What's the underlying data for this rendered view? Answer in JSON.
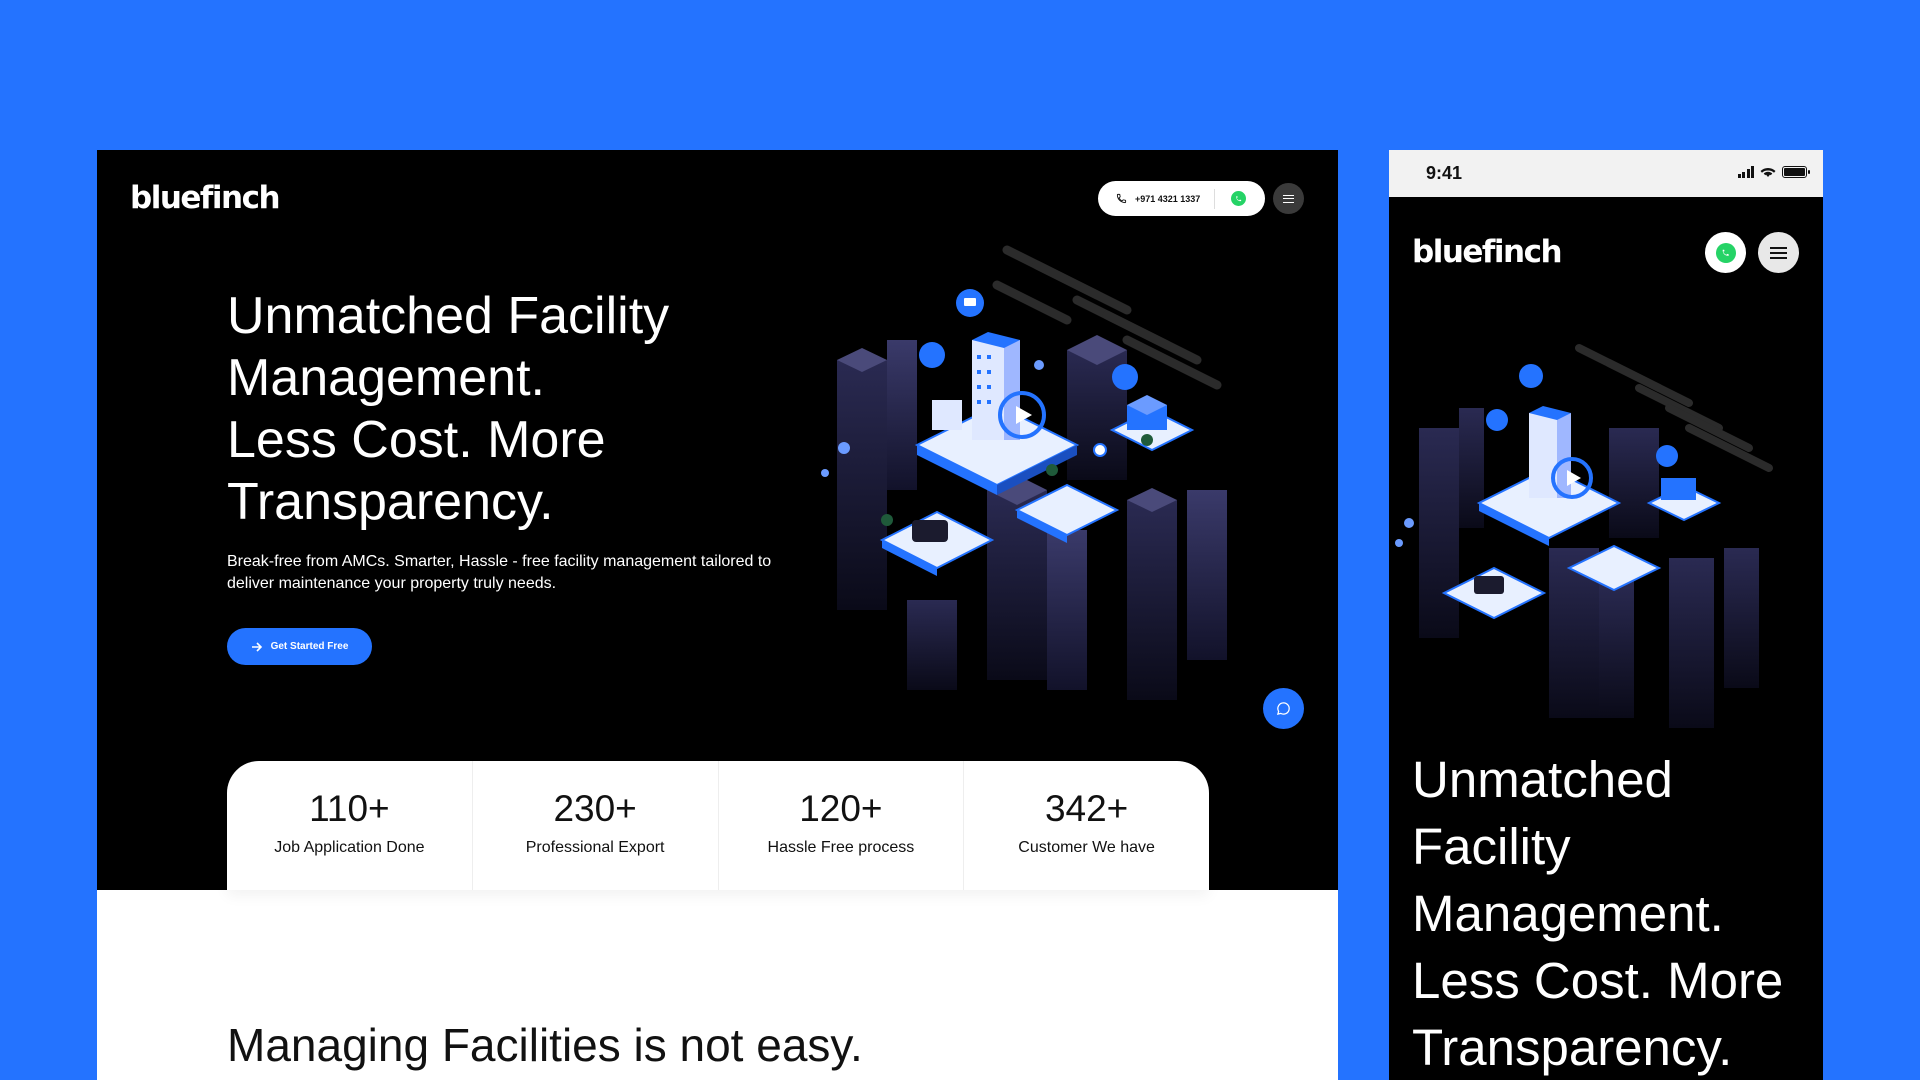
{
  "desktop": {
    "logo": "bluefinch",
    "phone_number": "+971 4321 1337",
    "headline": [
      "Unmatched Facility",
      "Management.",
      "Less Cost. More",
      "Transparency."
    ],
    "subheadline": "Break-free from AMCs. Smarter, Hassle - free facility management tailored to deliver maintenance your property truly needs.",
    "cta_label": "Get Started Free",
    "stats": [
      {
        "value": "110+",
        "label": "Job Application Done"
      },
      {
        "value": "230+",
        "label": "Professional Export"
      },
      {
        "value": "120+",
        "label": "Hassle Free process"
      },
      {
        "value": "342+",
        "label": "Customer We have"
      }
    ],
    "section_title": "Managing Facilities is not easy."
  },
  "mobile": {
    "time": "9:41",
    "logo": "bluefinch",
    "headline": [
      "Unmatched",
      "Facility",
      "Management.",
      "Less Cost. More",
      "Transparency."
    ]
  },
  "icons": [
    "phone-icon",
    "whatsapp-icon",
    "menu-icon",
    "arrow-right-icon",
    "chat-icon",
    "play-icon",
    "signal-icon",
    "wifi-icon",
    "battery-icon"
  ],
  "colors": {
    "background": "#2473FF",
    "accent": "#2473FF",
    "hero": "#000000",
    "whatsapp": "#25D366"
  }
}
